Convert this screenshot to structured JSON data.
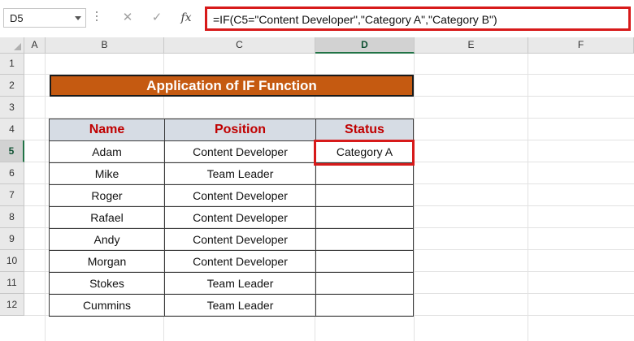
{
  "formula_bar": {
    "name_box": "D5",
    "cancel_glyph": "✕",
    "enter_glyph": "✓",
    "fx_label": "fx",
    "formula": "=IF(C5=\"Content Developer\",\"Category A\",\"Category B\")"
  },
  "columns": [
    "A",
    "B",
    "C",
    "D",
    "E",
    "F"
  ],
  "rows": [
    "1",
    "2",
    "3",
    "4",
    "5",
    "6",
    "7",
    "8",
    "9",
    "10",
    "11",
    "12"
  ],
  "selected_cell": {
    "column": "D",
    "row": "5"
  },
  "title": "Application of IF Function",
  "table": {
    "headers": [
      "Name",
      "Position",
      "Status"
    ],
    "rows": [
      [
        "Adam",
        "Content Developer",
        "Category A"
      ],
      [
        "Mike",
        "Team Leader",
        ""
      ],
      [
        "Roger",
        "Content Developer",
        ""
      ],
      [
        "Rafael",
        "Content Developer",
        ""
      ],
      [
        "Andy",
        "Content Developer",
        ""
      ],
      [
        "Morgan",
        "Content Developer",
        ""
      ],
      [
        "Stokes",
        "Team Leader",
        ""
      ],
      [
        "Cummins",
        "Team Leader",
        ""
      ]
    ]
  },
  "colors": {
    "title_fill": "#c55a11",
    "header_fill": "#d6dce4",
    "header_text": "#c00000",
    "highlight": "#d71a1a",
    "excel_green": "#217346"
  },
  "icons": [
    "dropdown-arrow-icon",
    "cancel-icon",
    "enter-icon",
    "function-icon",
    "select-all-icon"
  ]
}
